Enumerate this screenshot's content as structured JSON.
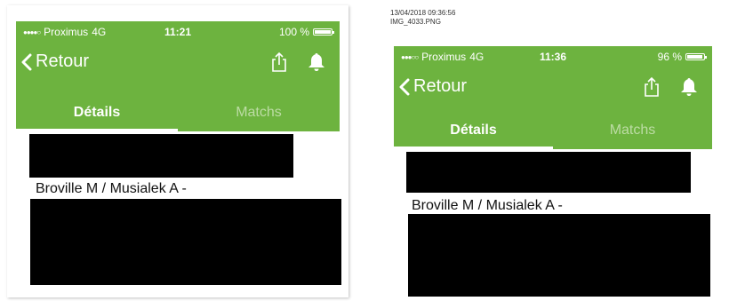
{
  "screens": [
    {
      "status": {
        "carrier": "Proximus",
        "network": "4G",
        "time": "11:21",
        "battery_text": "100 %",
        "battery_level": 1.0
      },
      "nav": {
        "back_label": "Retour"
      },
      "tabs": [
        {
          "label": "Détails",
          "active": true
        },
        {
          "label": "Matchs",
          "active": false
        }
      ],
      "content": {
        "name_line": "Broville M / Musialek A -"
      }
    },
    {
      "meta": {
        "timestamp": "13/04/2018 09:36:56",
        "filename": "IMG_4033.PNG"
      },
      "status": {
        "carrier": "Proximus",
        "network": "4G",
        "time": "11:36",
        "battery_text": "96 %",
        "battery_level": 0.96
      },
      "nav": {
        "back_label": "Retour"
      },
      "tabs": [
        {
          "label": "Détails",
          "active": true
        },
        {
          "label": "Matchs",
          "active": false
        }
      ],
      "content": {
        "name_line": "Broville M / Musialek A -"
      }
    }
  ],
  "icons": {
    "back": "chevron-left-icon",
    "share": "share-icon",
    "bell": "bell-icon"
  },
  "colors": {
    "brand_green": "#6db33f",
    "inactive_tab": "#bcdca4",
    "redaction": "#000000"
  }
}
